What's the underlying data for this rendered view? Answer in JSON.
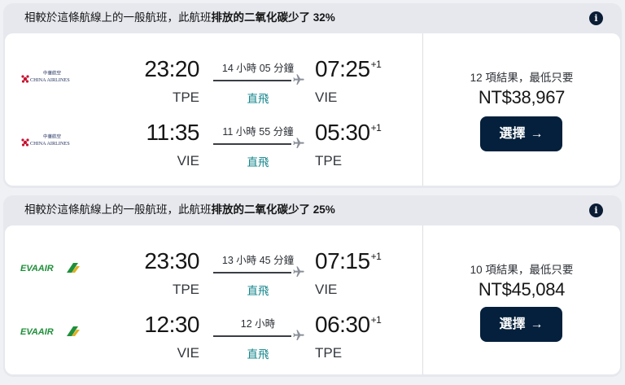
{
  "itineraries": [
    {
      "eco_notice": {
        "prefix": "相較於這條航線上的一般航班，此航班",
        "emphasis": "排放的二氧化碳少了 32%"
      },
      "airline": "China Airlines",
      "logo_text": {
        "chinese": "中華航空",
        "english": "CHINA AIRLINES"
      },
      "legs": [
        {
          "departure_time": "23:20",
          "departure_airport": "TPE",
          "duration": "14 小時 05 分鐘",
          "stops": "直飛",
          "arrival_time": "07:25",
          "arrival_offset": "+1",
          "arrival_airport": "VIE"
        },
        {
          "departure_time": "11:35",
          "departure_airport": "VIE",
          "duration": "11 小時 55 分鐘",
          "stops": "直飛",
          "arrival_time": "05:30",
          "arrival_offset": "+1",
          "arrival_airport": "TPE"
        }
      ],
      "results_text": "12 項結果，最低只要",
      "price": "NT$38,967",
      "select_label": "選擇"
    },
    {
      "eco_notice": {
        "prefix": "相較於這條航線上的一般航班，此航班",
        "emphasis": "排放的二氧化碳少了 25%"
      },
      "airline": "EVA Air",
      "logo_text": {
        "english": "EVAAIR"
      },
      "legs": [
        {
          "departure_time": "23:30",
          "departure_airport": "TPE",
          "duration": "13 小時 45 分鐘",
          "stops": "直飛",
          "arrival_time": "07:15",
          "arrival_offset": "+1",
          "arrival_airport": "VIE"
        },
        {
          "departure_time": "12:30",
          "departure_airport": "VIE",
          "duration": "12 小時",
          "stops": "直飛",
          "arrival_time": "06:30",
          "arrival_offset": "+1",
          "arrival_airport": "TPE"
        }
      ],
      "results_text": "10 項結果，最低只要",
      "price": "NT$45,084",
      "select_label": "選擇"
    }
  ],
  "icons": {
    "info": "info-icon",
    "plane": "plane-icon",
    "arrow": "arrow-right-icon"
  },
  "colors": {
    "button_bg": "#05203c",
    "direct_text": "#0c838a",
    "china_airlines_red": "#c8102e",
    "eva_green": "#1f8f3a"
  }
}
